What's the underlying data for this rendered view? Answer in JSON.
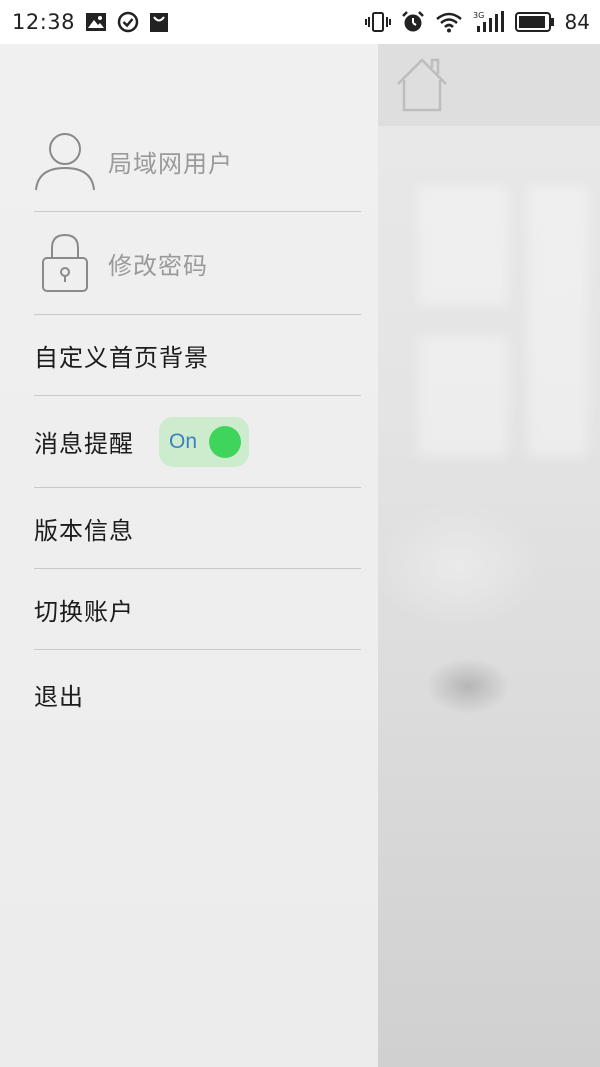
{
  "status_bar": {
    "time": "12:38",
    "battery_percent": "84",
    "left_icons": [
      "image-icon",
      "check-circle-icon",
      "shopping-bag-icon"
    ],
    "right_icons": [
      "vibrate-icon",
      "alarm-icon",
      "wifi-icon",
      "signal-3g-icon",
      "battery-icon"
    ],
    "network_label": "3G"
  },
  "drawer": {
    "user": {
      "label": "局域网用户",
      "icon": "user-icon"
    },
    "change_password": {
      "label": "修改密码",
      "icon": "lock-icon"
    },
    "items": [
      {
        "label": "自定义首页背景"
      },
      {
        "label": "消息提醒",
        "toggle": {
          "text": "On",
          "state": true
        }
      },
      {
        "label": "版本信息"
      },
      {
        "label": "切换账户"
      },
      {
        "label": "退出"
      }
    ]
  },
  "background_app": {
    "header_icon": "home-icon"
  },
  "colors": {
    "toggle_bg": "#cdeccd",
    "toggle_knob": "#3fd45c",
    "toggle_text": "#3d7fc1",
    "drawer_bg": "#eeeeee",
    "divider": "#c9c9c9"
  }
}
